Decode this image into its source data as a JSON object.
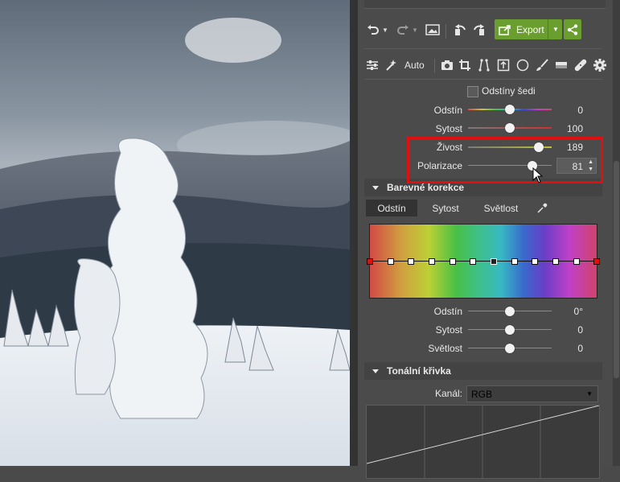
{
  "toolbar": {
    "export_label": "Export",
    "auto_label": "Auto"
  },
  "adjust": {
    "grayscale_label": "Odstíny šedi",
    "rows": [
      {
        "label": "Odstín",
        "value": "0",
        "pos": 0.5
      },
      {
        "label": "Sytost",
        "value": "100",
        "pos": 0.5
      },
      {
        "label": "Živost",
        "value": "189",
        "pos": 0.85
      },
      {
        "label": "Polarizace",
        "value": "81",
        "pos": 0.77
      }
    ]
  },
  "color_correction": {
    "title": "Barevné korekce",
    "tabs": [
      "Odstín",
      "Sytost",
      "Světlost"
    ],
    "rows": [
      {
        "label": "Odstín",
        "value": "0°"
      },
      {
        "label": "Sytost",
        "value": "0"
      },
      {
        "label": "Světlost",
        "value": "0"
      }
    ]
  },
  "tone_curve": {
    "title": "Tonální křivka",
    "channel_label": "Kanál:",
    "channel_value": "RGB"
  },
  "colors": {
    "accent_green": "#6a9e2f",
    "highlight_red": "#e01010"
  }
}
